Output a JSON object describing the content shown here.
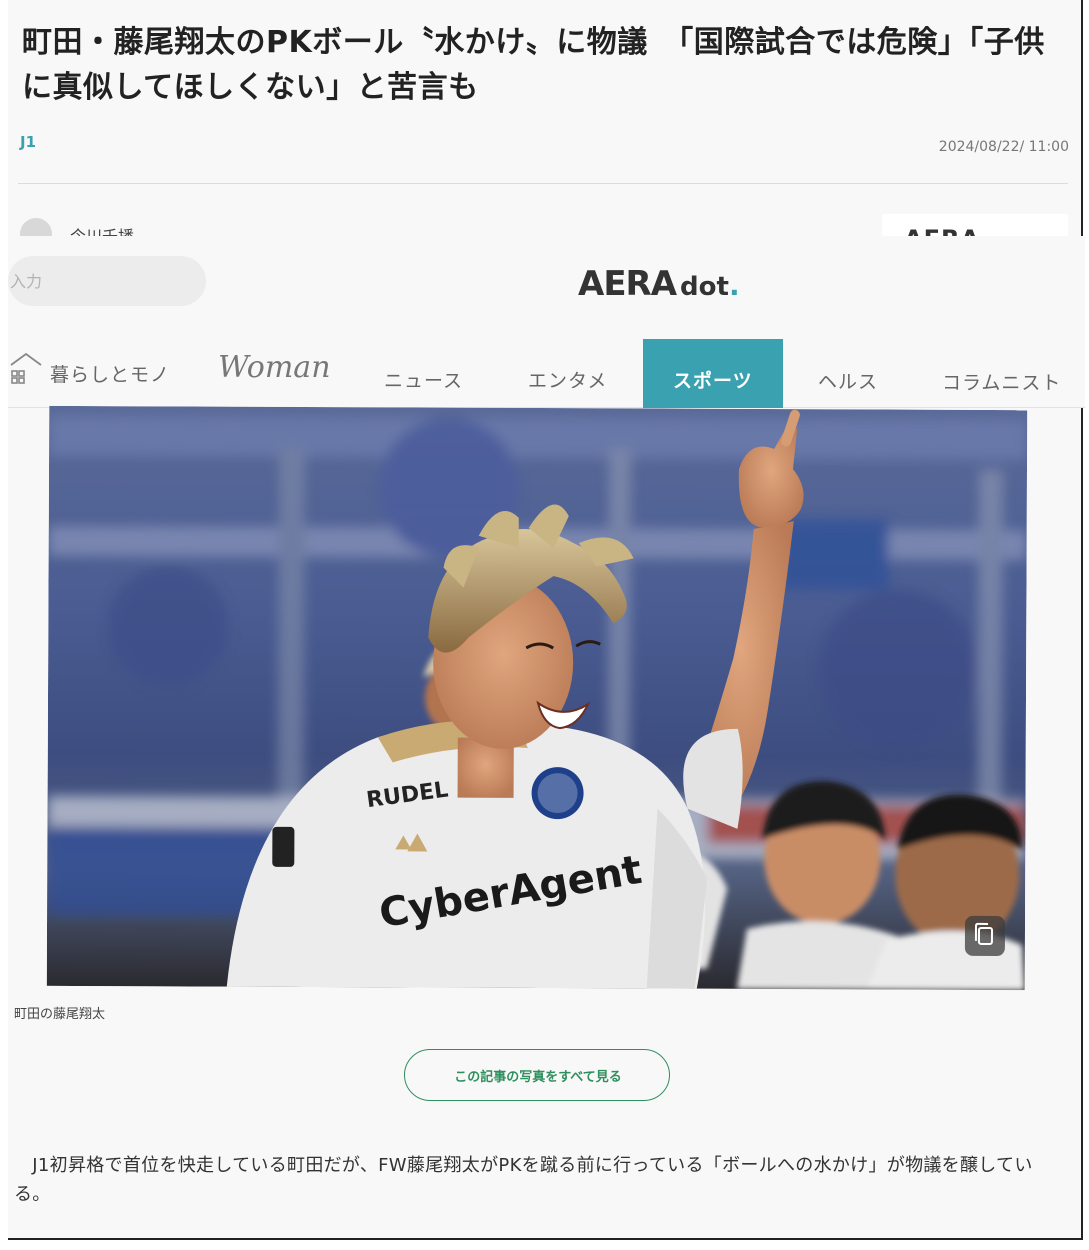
{
  "article": {
    "title": "町田・藤尾翔太のPKボール〝水かけ〟に物議　「国際試合では危険」「子供に真似してほしくない」と苦言も",
    "category": "J1",
    "date": "2024/08/22/ 11:00",
    "author": "今川千播",
    "caption": "町田の藤尾翔太",
    "view_all_photos": "この記事の写真をすべて見る",
    "body": "　J1初昇格で首位を快走している町田だが、FW藤尾翔太がPKを蹴る前に行っている「ボールへの水かけ」が物議を醸している。"
  },
  "header": {
    "partial_logo": "AERA",
    "search_placeholder": "入力",
    "logo_main": "AERA",
    "logo_sub": "dot",
    "logo_dot": "."
  },
  "nav": {
    "kurashi": "暮らしとモノ",
    "woman": "Woman",
    "news": "ニュース",
    "enta": "エンタメ",
    "sports": "スポーツ",
    "health": "ヘルス",
    "columnist": "コラムニスト"
  },
  "photo": {
    "sponsor_sleeve": "RUDEL",
    "sponsor_chest": "CyberAgent"
  },
  "colors": {
    "accent": "#3aa1b0",
    "button_green": "#2f8f5e"
  }
}
